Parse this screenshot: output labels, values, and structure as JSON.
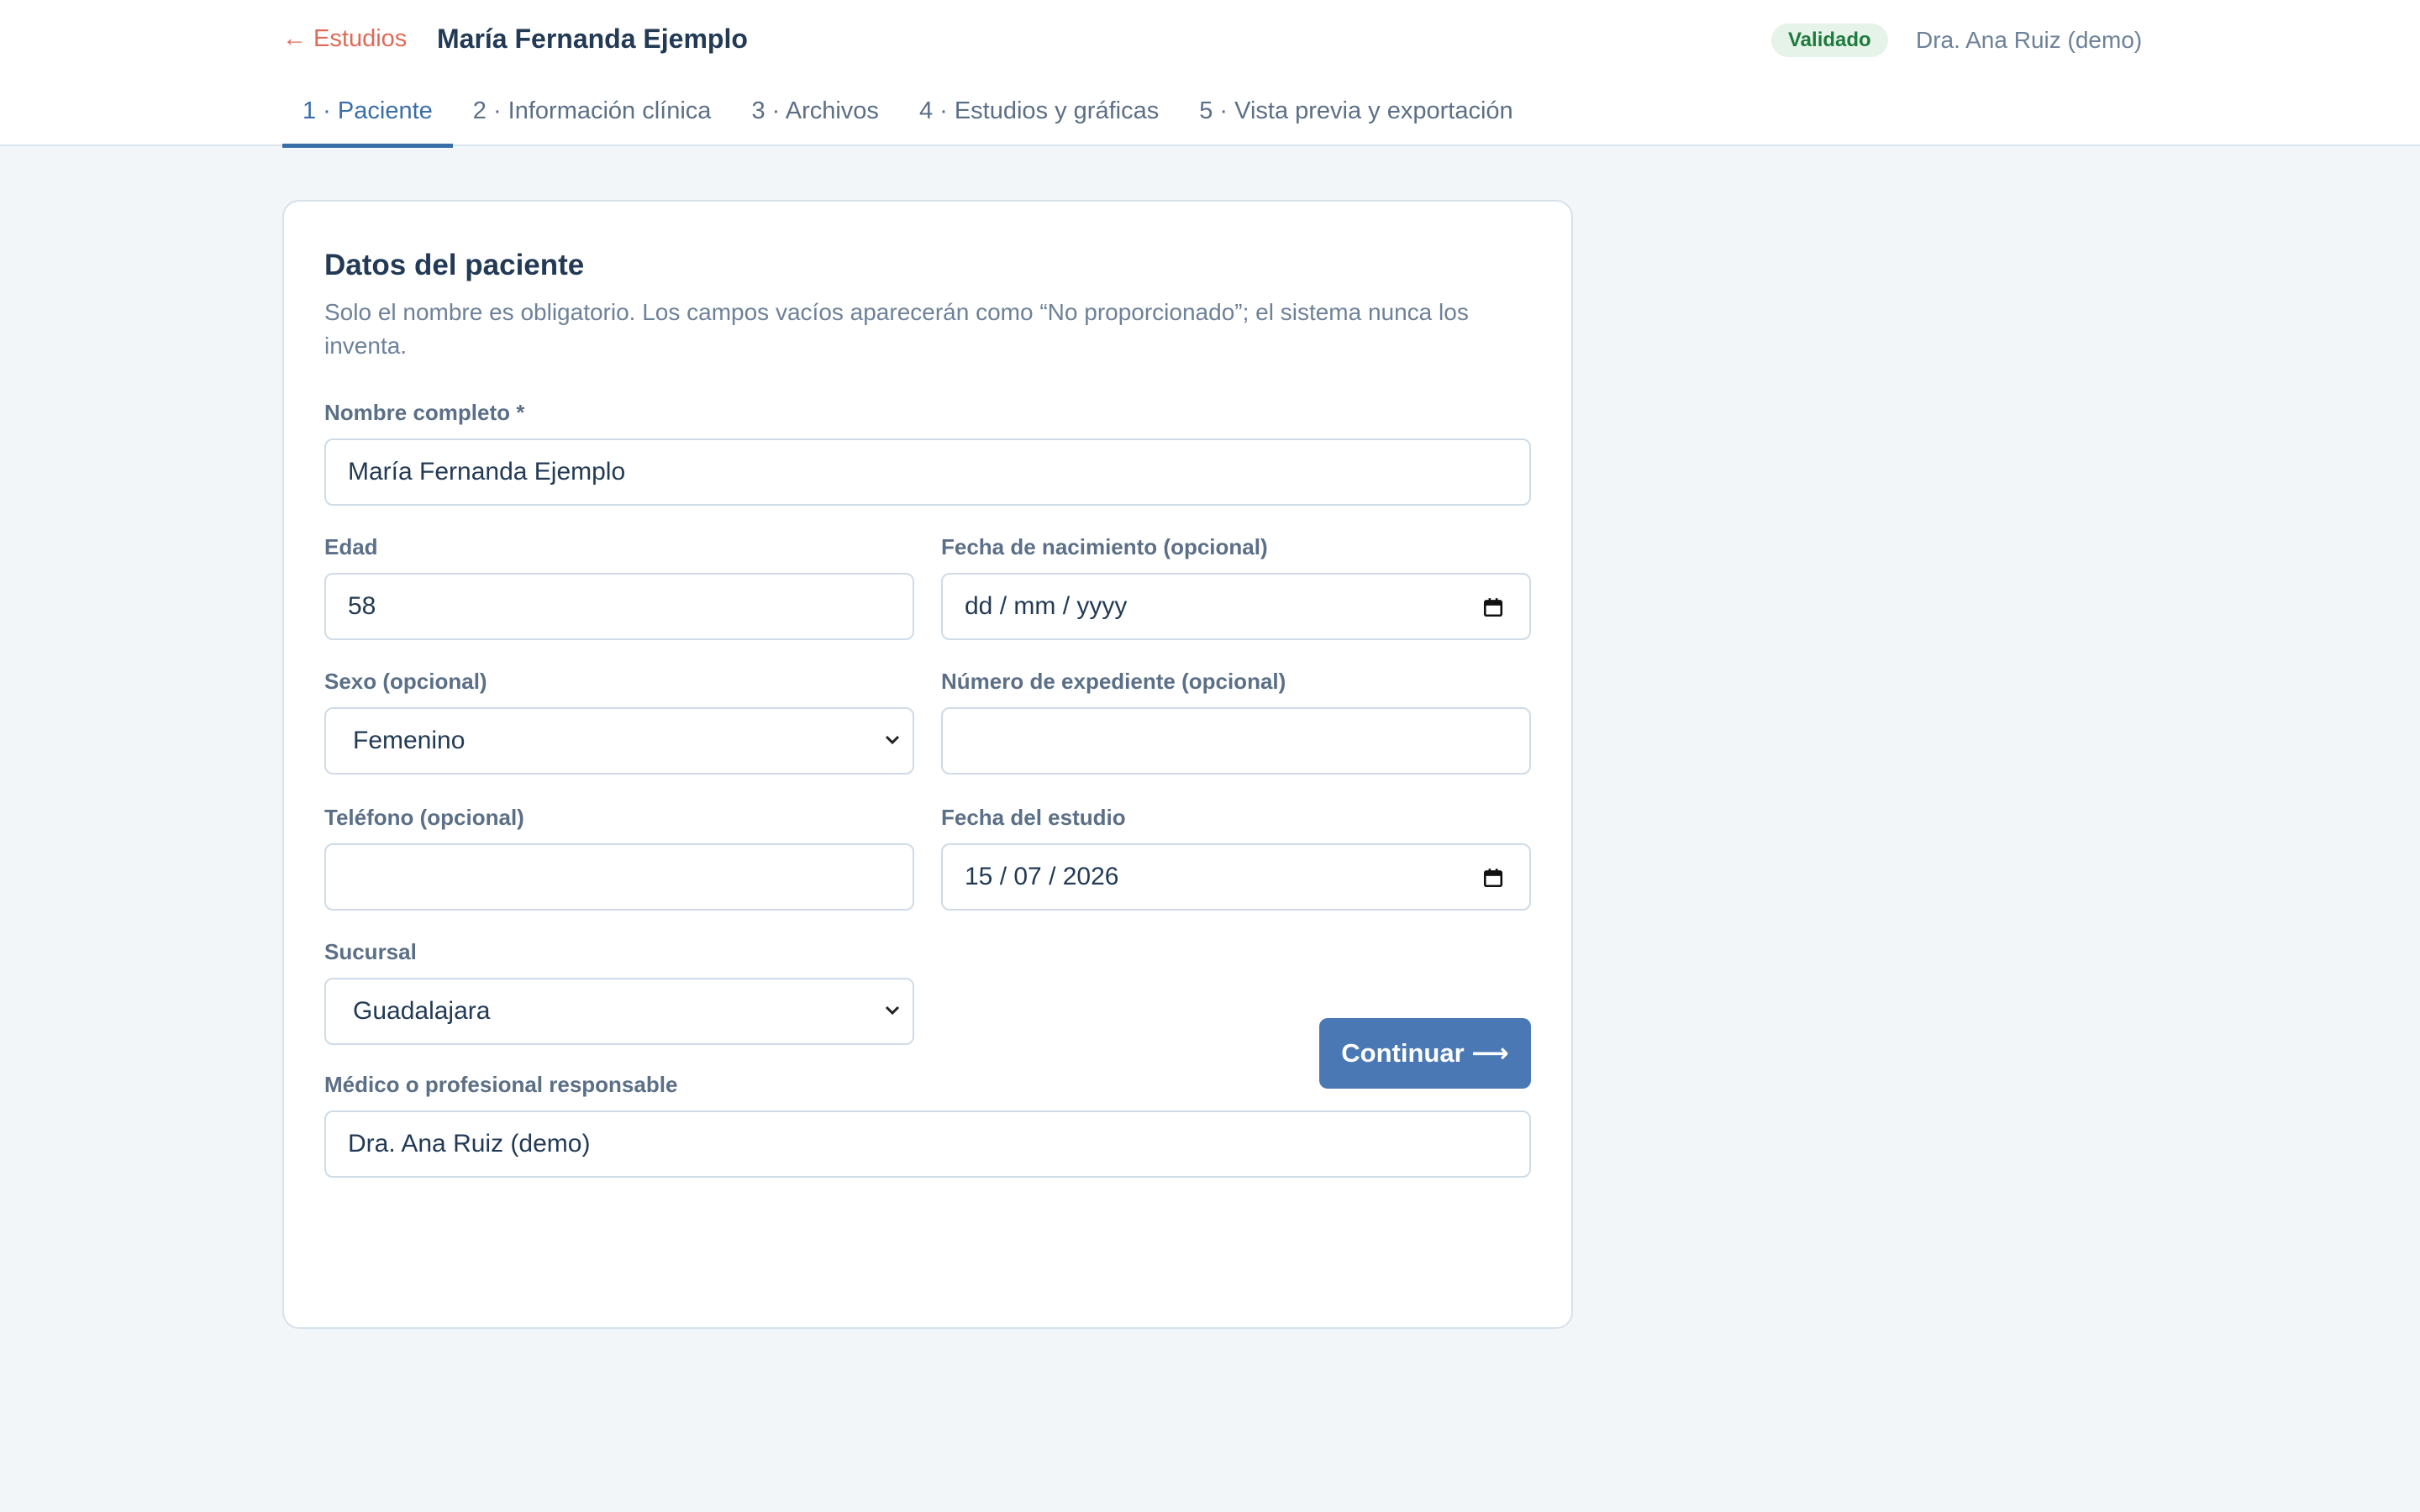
{
  "header": {
    "back_label": "← Estudios",
    "title": "María Fernanda Ejemplo",
    "status": "Validado",
    "user": "Dra. Ana Ruiz (demo)"
  },
  "tabs": [
    {
      "label": "1 · Paciente",
      "active": true
    },
    {
      "label": "2 · Información clínica",
      "active": false
    },
    {
      "label": "3 · Archivos",
      "active": false
    },
    {
      "label": "4 · Estudios y gráficas",
      "active": false
    },
    {
      "label": "5 · Vista previa y exportación",
      "active": false
    }
  ],
  "form": {
    "title": "Datos del paciente",
    "description": "Solo el nombre es obligatorio. Los campos vacíos aparecerán como “No proporcionado”; el sistema nunca los inventa.",
    "full_name": {
      "label": "Nombre completo *",
      "value": "María Fernanda Ejemplo"
    },
    "age": {
      "label": "Edad",
      "value": "58"
    },
    "birth_date": {
      "label": "Fecha de nacimiento (opcional)",
      "value": "dd / mm / yyyy"
    },
    "sex": {
      "label": "Sexo (opcional)",
      "value": "Femenino"
    },
    "record_number": {
      "label": "Número de expediente (opcional)",
      "value": ""
    },
    "phone": {
      "label": "Teléfono (opcional)",
      "value": ""
    },
    "study_date": {
      "label": "Fecha del estudio",
      "value": "15 / 07 / 2026"
    },
    "branch": {
      "label": "Sucursal",
      "value": "Guadalajara"
    },
    "physician": {
      "label": "Médico o profesional responsable",
      "value": "Dra. Ana Ruiz (demo)"
    },
    "continue_label": "Continuar ⟶"
  },
  "colors": {
    "accent": "#4a78b4",
    "back_link": "#e06a58",
    "badge_bg": "#e5f3e9",
    "badge_text": "#1f7a3d"
  }
}
